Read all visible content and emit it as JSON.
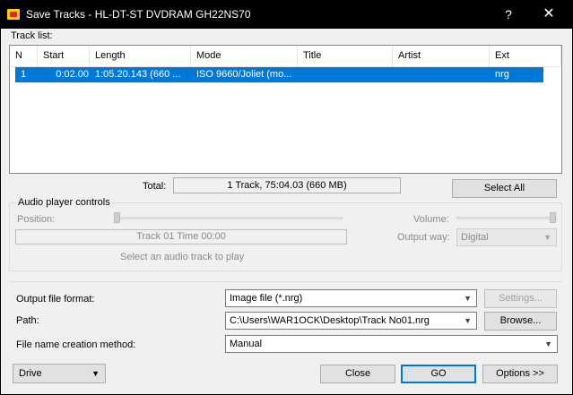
{
  "window": {
    "title": "Save Tracks - HL-DT-ST DVDRAM GH22NS70",
    "help_label": "?",
    "close_label": "✕"
  },
  "tracklist": {
    "label": "Track list:",
    "columns": [
      "N",
      "Start",
      "Length",
      "Mode",
      "Title",
      "Artist",
      "Ext"
    ],
    "rows": [
      {
        "n": "1",
        "start": "0:02.00",
        "length": "1:05.20.143 (660 ...",
        "mode": "ISO 9660/Joliet (mo...",
        "title": "",
        "artist": "",
        "ext": "nrg"
      }
    ]
  },
  "total": {
    "label": "Total:",
    "value": "1 Track,   75:04.03 (660 MB)"
  },
  "select_all_label": "Select All",
  "audio": {
    "group_label": "Audio player controls",
    "position_label": "Position:",
    "volume_label": "Volume:",
    "progress_text": "Track 01 Time 00:00",
    "output_way_label": "Output way:",
    "output_way_value": "Digital",
    "hint": "Select an audio track to play"
  },
  "output": {
    "format_label": "Output file format:",
    "format_value": "Image file (*.nrg)",
    "settings_label": "Settings...",
    "path_label": "Path:",
    "path_value": "C:\\Users\\WAR1OCK\\Desktop\\Track No01.nrg",
    "browse_label": "Browse...",
    "naming_label": "File name creation method:",
    "naming_value": "Manual"
  },
  "footer": {
    "drive_label": "Drive",
    "close_label": "Close",
    "go_label": "GO",
    "options_label": "Options >>"
  },
  "colors": {
    "selection": "#0078d7",
    "titlebar": "#000000"
  }
}
